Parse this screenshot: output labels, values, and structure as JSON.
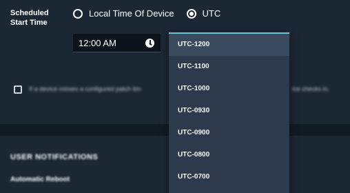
{
  "start_time": {
    "label_line1": "Scheduled",
    "label_line2": "Start Time",
    "options": [
      {
        "label": "Local Time Of Device",
        "selected": false
      },
      {
        "label": "UTC",
        "selected": true
      }
    ],
    "time_value": "12:00 AM"
  },
  "patch_note": {
    "text_left": "If a device misses a configured patch tim",
    "text_right": "ice checks in."
  },
  "user_notifications": {
    "heading": "USER NOTIFICATIONS",
    "automatic_reboot_label": "Automatic Reboot"
  },
  "timezone_dropdown": {
    "items": [
      "UTC-1200",
      "UTC-1100",
      "UTC-1000",
      "UTC-0930",
      "UTC-0900",
      "UTC-0800",
      "UTC-0700"
    ],
    "highlighted_index": 0
  },
  "colors": {
    "background": "#1c2734",
    "dropdown_bg": "#2c3a4b",
    "dropdown_accent": "#6ec1d9",
    "input_bg": "#0c131b"
  }
}
